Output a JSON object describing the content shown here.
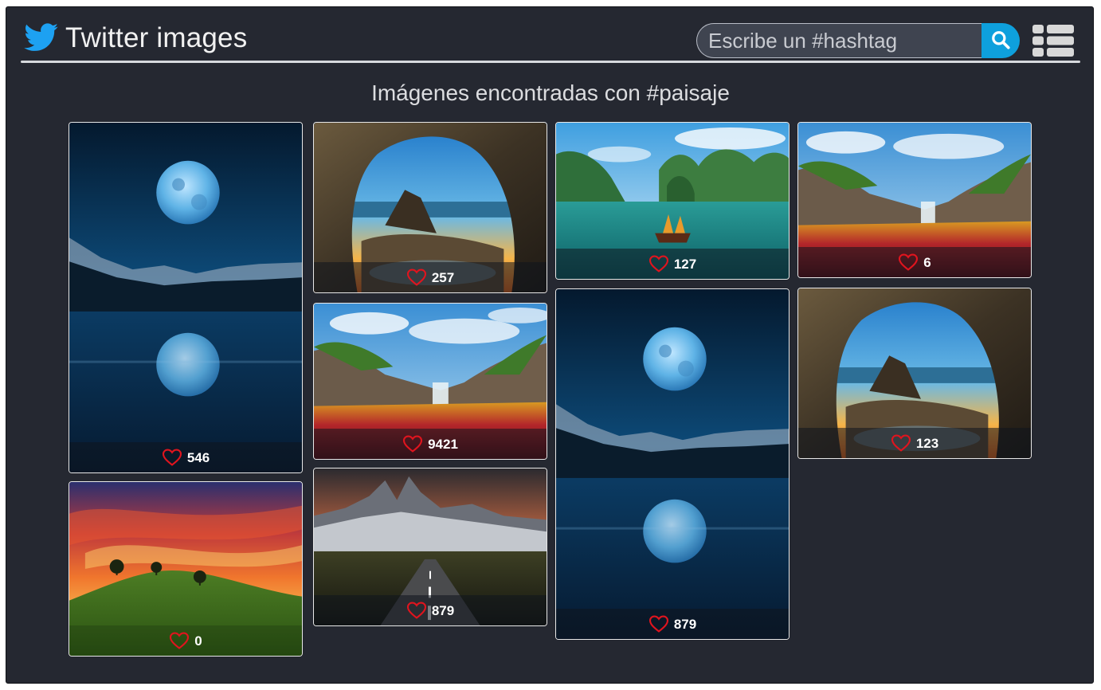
{
  "header": {
    "title": "Twitter images",
    "search_placeholder": "Escribe un #hashtag"
  },
  "results": {
    "heading": "Imágenes encontradas con #paisaje"
  },
  "cards": [
    {
      "scene": "moon-lake",
      "likes": "546"
    },
    {
      "scene": "sunset-hill",
      "likes": "0"
    },
    {
      "scene": "sea-cave",
      "likes": "257"
    },
    {
      "scene": "red-river",
      "likes": "9421"
    },
    {
      "scene": "mountain-road",
      "likes": "879"
    },
    {
      "scene": "bay-islands",
      "likes": "127"
    },
    {
      "scene": "moon-lake",
      "likes": "879"
    },
    {
      "scene": "red-river",
      "likes": "6"
    },
    {
      "scene": "sea-cave",
      "likes": "123"
    }
  ],
  "colors": {
    "panel": "#252831",
    "accent": "#0ea0dd",
    "twitter_blue": "#1da1f2",
    "heart": "#e0141e"
  },
  "icons": {
    "brand": "twitter-bird-icon",
    "search": "search-icon",
    "menu": "list-view-icon",
    "like": "heart-icon"
  }
}
